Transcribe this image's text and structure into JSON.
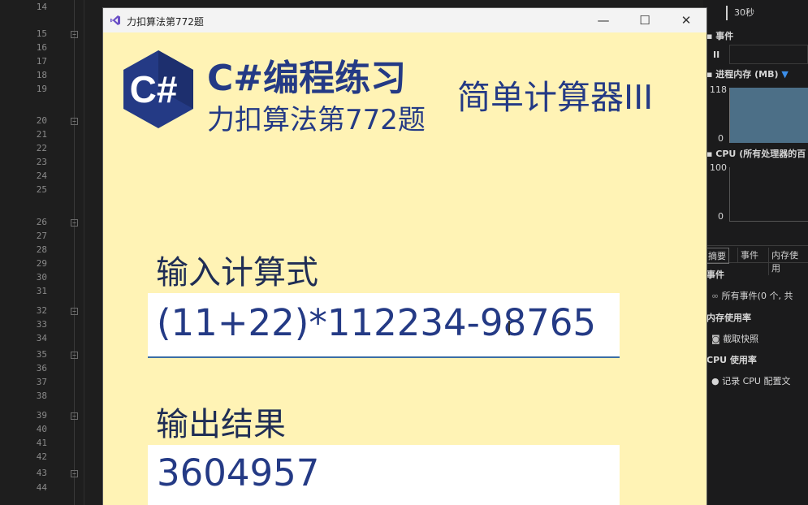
{
  "editor": {
    "line_numbers": [
      "14",
      "15",
      "16",
      "17",
      "18",
      "19",
      "20",
      "21",
      "22",
      "23",
      "24",
      "25",
      "26",
      "27",
      "28",
      "29",
      "30",
      "31",
      "32",
      "33",
      "34",
      "35",
      "36",
      "37",
      "38",
      "39",
      "40",
      "41",
      "42",
      "43",
      "44"
    ],
    "fold_marker": "⊟"
  },
  "diagnostics": {
    "interval_label": "30秒",
    "events_header": "事件",
    "pause_glyph": "II",
    "memory_header": "进程内存 (MB)",
    "memory_max": "118",
    "memory_min": "0",
    "cpu_header": "CPU (所有处理器的百",
    "cpu_max": "100",
    "cpu_min": "0",
    "tabs": [
      "摘要",
      "事件",
      "内存使用"
    ],
    "section_events": "事件",
    "all_events": "所有事件(0 个, 共",
    "section_memory": "内存使用率",
    "take_snapshot": "截取快照",
    "section_cpu": "CPU 使用率",
    "record_cpu": "记录 CPU 配置文",
    "colors": {
      "memory_fill": "#4c6f87",
      "panel_bg": "#1b1b1c"
    }
  },
  "window": {
    "title": "力扣算法第772题",
    "minimize": "—",
    "maximize": "☐",
    "close": "✕"
  },
  "header": {
    "logo_text": "C#",
    "title": "C#编程练习",
    "subtitle": "力扣算法第772题",
    "problem": "简单计算器III",
    "colors": {
      "brand": "#243a85",
      "background": "#fff3b5"
    }
  },
  "input": {
    "label": "输入计算式",
    "value": "(11+22)*112234-98765"
  },
  "output": {
    "label": "输出结果",
    "value": "3604957"
  }
}
